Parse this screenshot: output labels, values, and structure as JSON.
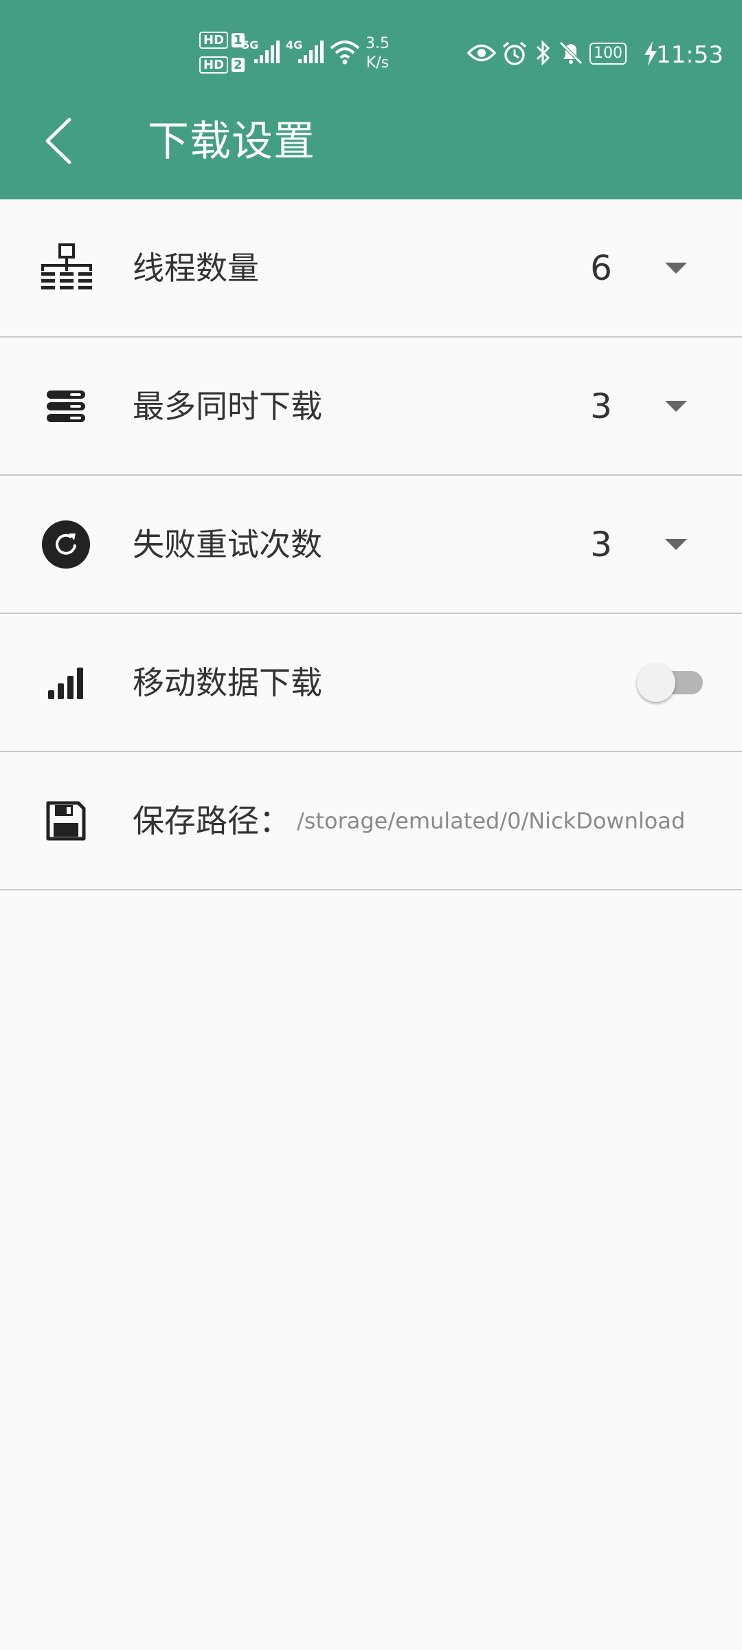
{
  "status_bar": {
    "hd1": "HD",
    "sim1": "1",
    "hd2": "HD",
    "sim2": "2",
    "net1": "5G",
    "net2": "4G",
    "speed_value": "3.5",
    "speed_unit": "K/s",
    "battery": "100",
    "time": "11:53",
    "icons": [
      "eye-icon",
      "alarm-icon",
      "bluetooth-icon",
      "mute-bell-icon",
      "charging-icon"
    ]
  },
  "toolbar": {
    "back_icon": "chevron-left-icon",
    "title": "下载设置"
  },
  "settings": [
    {
      "label": "线程数量",
      "value": "6",
      "icon": "network-icon"
    },
    {
      "label": "最多同时下载",
      "value": "3",
      "icon": "stack-icon"
    },
    {
      "label": "失败重试次数",
      "value": "3",
      "icon": "refresh-icon"
    },
    {
      "label": "移动数据下载",
      "toggle": false,
      "icon": "signal-bars-icon"
    },
    {
      "label": "保存路径：",
      "value": "/storage/emulated/0/NickDownload",
      "icon": "save-icon"
    }
  ],
  "colors": {
    "primary": "#439e83",
    "text": "#333333",
    "secondary_text": "#8a8a8a",
    "divider": "#c9c9c9"
  }
}
